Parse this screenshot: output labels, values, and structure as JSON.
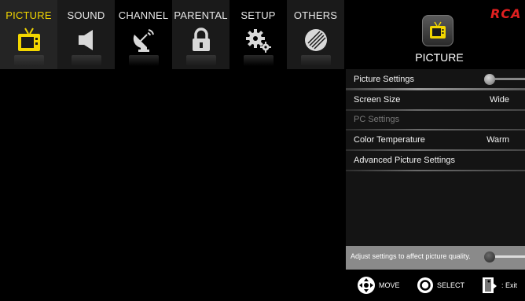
{
  "tabs": [
    {
      "label": "PICTURE",
      "icon": "tv-icon",
      "selected": true
    },
    {
      "label": "SOUND",
      "icon": "speaker-icon",
      "selected": false
    },
    {
      "label": "CHANNEL",
      "icon": "satellite-dish-icon",
      "selected": false
    },
    {
      "label": "PARENTAL",
      "icon": "padlock-icon",
      "selected": false
    },
    {
      "label": "SETUP",
      "icon": "gears-icon",
      "selected": false
    },
    {
      "label": "OTHERS",
      "icon": "disc-icon",
      "selected": false
    }
  ],
  "header": {
    "brand": "RCA",
    "section_title": "PICTURE",
    "section_icon": "tv-icon"
  },
  "menu": {
    "items": [
      {
        "label": "Picture Settings",
        "value": "",
        "enabled": true,
        "highlighted": true
      },
      {
        "label": "Screen Size",
        "value": "Wide",
        "enabled": true,
        "highlighted": false
      },
      {
        "label": "PC Settings",
        "value": "",
        "enabled": false,
        "highlighted": false
      },
      {
        "label": "Color Temperature",
        "value": "Warm",
        "enabled": true,
        "highlighted": false
      },
      {
        "label": "Advanced Picture Settings",
        "value": "",
        "enabled": true,
        "highlighted": false
      }
    ]
  },
  "help": {
    "text": "Adjust settings to affect picture quality."
  },
  "footer": {
    "move": "MOVE",
    "select": "SELECT",
    "exit": ": Exit"
  },
  "colors": {
    "selected_tab_text": "#f2d600",
    "brand_red": "#e02020",
    "panel_bg": "#141414"
  }
}
